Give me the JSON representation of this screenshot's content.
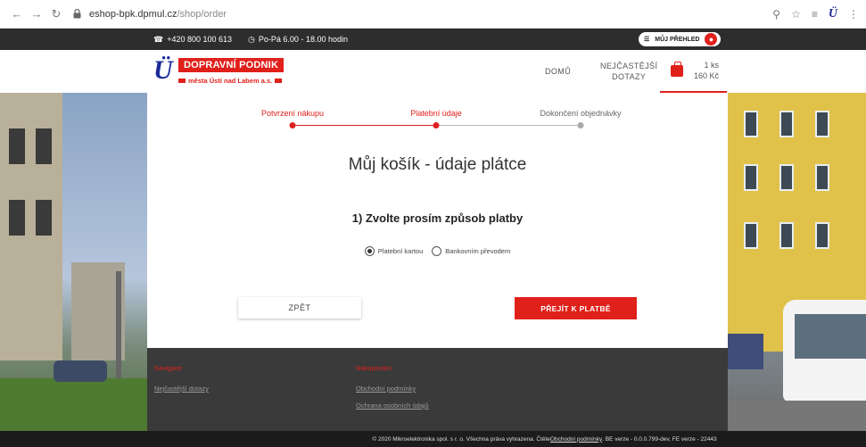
{
  "browser": {
    "url_host": "eshop-bpk.dpmul.cz",
    "url_path": "/shop/order"
  },
  "topbar": {
    "phone": "+420 800 100 613",
    "hours": "Po-Pá 6.00 - 18.00 hodin",
    "my_overview": "MŮJ PŘEHLED"
  },
  "logo": {
    "title": "DOPRAVNÍ PODNIK",
    "subtitle": "města Ústí nad Labem a.s."
  },
  "header": {
    "nav_home": "DOMŮ",
    "nav_faq": "NEJČASTĚJŠÍ DOTAZY",
    "cart_qty": "1 ks",
    "cart_price": "160 Kč"
  },
  "steps": [
    {
      "label": "Potvrzení nákupu",
      "state": "done"
    },
    {
      "label": "Platební údaje",
      "state": "active"
    },
    {
      "label": "Dokončení objednávky",
      "state": "todo"
    }
  ],
  "main": {
    "title": "Můj košík - údaje plátce",
    "section_title": "1) Zvolte prosím způsob platby",
    "payment_options": [
      {
        "label": "Platební kartou",
        "checked": true
      },
      {
        "label": "Bankovním převodem",
        "checked": false
      }
    ],
    "back_label": "ZPĚT",
    "pay_label": "PŘEJÍT K PLATBĚ"
  },
  "footer": {
    "nav_heading": "Navigace",
    "nav_links": [
      "Nejčastější dotazy"
    ],
    "shop_heading": "Nakupování",
    "shop_links": [
      "Obchodní podmínky",
      "Ochrana osobních údajů"
    ],
    "copyright_prefix": "© 2020 Mikroelektronika spol. s r. o. Všechna práva vyhrazena. Čtěte ",
    "copyright_link": "Obchodní podmínky",
    "copyright_suffix": ". BE verze - 0.0.0.799-dev, FE verze - 22443"
  },
  "colors": {
    "accent": "#e0201b",
    "brand_blue": "#1a2a9a",
    "dark": "#2d2d2d"
  }
}
